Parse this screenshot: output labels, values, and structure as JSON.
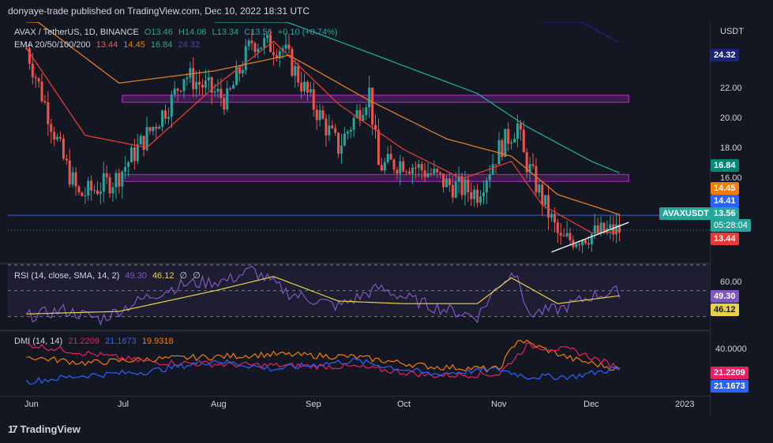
{
  "header": {
    "published": "donyaye-trade published on TradingView.com, Dec 10, 2022 18:31 UTC"
  },
  "footer": {
    "brand": "TradingView"
  },
  "legend_main": {
    "symbol": "AVAX / TetherUS, 1D, BINANCE",
    "o": "O13.46",
    "h": "H14.06",
    "l": "L13.34",
    "c": "C13.56",
    "chg": "+0.10 (+0.74%)"
  },
  "legend_ema": {
    "label": "EMA 20/50/100/200",
    "v20": "13.44",
    "v50": "14.45",
    "v100": "16.84",
    "v200": "24.32"
  },
  "legend_rsi": {
    "label": "RSI (14, close, SMA, 14, 2)",
    "rsi": "49.30",
    "sma": "46.12",
    "z1": "∅",
    "z2": "∅"
  },
  "legend_dmi": {
    "label": "DMI (14, 14)",
    "plus": "21.2209",
    "minus": "21.1673",
    "adx": "19.9318"
  },
  "axis_unit": "USDT",
  "price_ticks": [
    "22.00",
    "20.00",
    "18.00",
    "16.00"
  ],
  "price_tags": {
    "ema200": "24.32",
    "ema100": "16.84",
    "ema50": "14.45",
    "hline": "14.41",
    "symbol": "AVAXUSDT",
    "last": "13.56",
    "countdown": "05:28:04",
    "ema20": "13.44"
  },
  "rsi_ticks": {
    "t60": "60.00"
  },
  "rsi_tags": {
    "rsi": "49.30",
    "sma": "46.12"
  },
  "dmi_ticks": {
    "t40": "40.0000"
  },
  "dmi_tags": {
    "plus": "21.2209",
    "minus": "21.1673"
  },
  "time_axis": [
    "Jun",
    "Jul",
    "Aug",
    "Sep",
    "Oct",
    "Nov",
    "Dec",
    "2023"
  ],
  "colors": {
    "bg": "#131722",
    "up": "#26a69a",
    "down": "#ef5350",
    "ema20": "#e53935",
    "ema50": "#e07b24",
    "ema100": "#26a69a",
    "ema200": "#1a237e",
    "zone": "#9c27b0",
    "hline": "#2962ff",
    "rsi": "#7e57c2",
    "rsi_sma": "#e8d24a",
    "dmi_plus": "#e91e63",
    "dmi_minus": "#2962ff",
    "adx": "#f57c00"
  },
  "chart_data": [
    {
      "type": "candlestick",
      "title": "AVAX / TetherUS, 1D, BINANCE",
      "x_range": [
        "2022-05-26",
        "2023-01-08"
      ],
      "ylim": [
        11.7,
        25.5
      ],
      "y_unit": "USDT",
      "series": [
        {
          "name": "price_close",
          "x": [
            "2022-06-01",
            "2022-06-13",
            "2022-06-18",
            "2022-06-30",
            "2022-07-08",
            "2022-07-18",
            "2022-07-22",
            "2022-08-05",
            "2022-08-13",
            "2022-08-23",
            "2022-09-01",
            "2022-09-10",
            "2022-09-20",
            "2022-09-23",
            "2022-10-01",
            "2022-10-10",
            "2022-10-15",
            "2022-10-25",
            "2022-11-01",
            "2022-11-07",
            "2022-11-09",
            "2022-11-21",
            "2022-11-30",
            "2022-12-10"
          ],
          "values": [
            24.0,
            17.6,
            15.5,
            16.5,
            18.5,
            21.0,
            22.5,
            21.0,
            24.4,
            24.0,
            21.0,
            18.3,
            21.5,
            17.2,
            17.5,
            16.8,
            16.2,
            15.7,
            18.2,
            19.6,
            17.8,
            12.9,
            13.3,
            13.56
          ]
        },
        {
          "name": "EMA 20",
          "x": [
            "2022-06-01",
            "2022-06-20",
            "2022-07-10",
            "2022-08-01",
            "2022-08-20",
            "2022-09-10",
            "2022-10-01",
            "2022-10-20",
            "2022-11-05",
            "2022-11-15",
            "2022-12-01",
            "2022-12-10"
          ],
          "values": [
            24.0,
            19.0,
            18.3,
            21.8,
            24.4,
            20.8,
            18.2,
            16.5,
            17.5,
            15.0,
            13.4,
            13.44
          ]
        },
        {
          "name": "EMA 50",
          "x": [
            "2022-06-01",
            "2022-07-01",
            "2022-08-01",
            "2022-08-25",
            "2022-09-20",
            "2022-10-15",
            "2022-11-05",
            "2022-11-20",
            "2022-12-10"
          ],
          "values": [
            26.0,
            22.0,
            22.7,
            23.6,
            21.0,
            18.8,
            17.8,
            15.6,
            14.45
          ]
        },
        {
          "name": "EMA 100",
          "x": [
            "2022-08-01",
            "2022-09-01",
            "2022-10-01",
            "2022-10-25",
            "2022-11-10",
            "2022-12-01",
            "2022-12-10"
          ],
          "values": [
            27.0,
            25.0,
            23.0,
            21.4,
            19.5,
            17.5,
            16.84
          ]
        },
        {
          "name": "EMA 200",
          "x": [
            "2022-11-15",
            "2022-12-10"
          ],
          "values": [
            26.7,
            24.32
          ]
        }
      ],
      "zones": [
        {
          "from": 20.9,
          "to": 21.3
        },
        {
          "from": 16.35,
          "to": 16.75
        }
      ],
      "hline": 14.41,
      "trendline": {
        "x": [
          "2022-11-18",
          "2022-12-13"
        ],
        "y": [
          12.3,
          14.0
        ]
      },
      "ticks": [
        "22.00",
        "20.00",
        "18.00",
        "16.00"
      ]
    },
    {
      "type": "line",
      "title": "RSI (14, close, SMA, 14, 2)",
      "ylim": [
        20,
        70
      ],
      "bands": [
        30,
        50,
        70
      ],
      "series": [
        {
          "name": "RSI",
          "x": [
            "2022-06-01",
            "2022-06-13",
            "2022-06-25",
            "2022-07-10",
            "2022-07-22",
            "2022-08-05",
            "2022-08-13",
            "2022-08-25",
            "2022-09-10",
            "2022-09-23",
            "2022-10-10",
            "2022-10-25",
            "2022-11-01",
            "2022-11-07",
            "2022-11-10",
            "2022-11-21",
            "2022-12-01",
            "2022-12-10"
          ],
          "values": [
            30,
            35,
            28,
            45,
            55,
            58,
            66,
            48,
            38,
            52,
            38,
            30,
            55,
            66,
            32,
            36,
            46,
            49.3
          ]
        },
        {
          "name": "SMA",
          "x": [
            "2022-06-01",
            "2022-07-01",
            "2022-08-01",
            "2022-08-20",
            "2022-09-10",
            "2022-10-01",
            "2022-10-25",
            "2022-11-05",
            "2022-11-20",
            "2022-12-10"
          ],
          "values": [
            32,
            34,
            50,
            61,
            42,
            40,
            40,
            60,
            40,
            46.12
          ]
        }
      ],
      "ticks": [
        "60.00"
      ]
    },
    {
      "type": "line",
      "title": "DMI (14, 14)",
      "ylim": [
        0,
        50
      ],
      "series": [
        {
          "name": "+DI",
          "x": [
            "2022-06-01",
            "2022-06-20",
            "2022-07-10",
            "2022-08-01",
            "2022-08-20",
            "2022-09-15",
            "2022-10-10",
            "2022-11-01",
            "2022-11-10",
            "2022-11-25",
            "2022-12-10"
          ],
          "values": [
            40,
            33,
            26,
            24,
            23,
            22,
            15,
            16,
            39,
            35,
            21.2209
          ]
        },
        {
          "name": "-DI",
          "x": [
            "2022-06-01",
            "2022-06-20",
            "2022-07-10",
            "2022-08-01",
            "2022-08-20",
            "2022-09-15",
            "2022-10-10",
            "2022-11-01",
            "2022-11-10",
            "2022-11-25",
            "2022-12-10"
          ],
          "values": [
            10,
            15,
            18,
            27,
            20,
            27,
            16,
            20,
            14,
            14,
            21.1673
          ]
        },
        {
          "name": "ADX",
          "x": [
            "2022-06-01",
            "2022-06-20",
            "2022-07-10",
            "2022-08-01",
            "2022-08-20",
            "2022-09-15",
            "2022-10-10",
            "2022-11-01",
            "2022-11-07",
            "2022-11-25",
            "2022-12-10"
          ],
          "values": [
            30,
            25,
            28,
            30,
            32,
            30,
            22,
            20,
            44,
            28,
            19.9318
          ]
        }
      ],
      "ticks": [
        "40.0000"
      ]
    }
  ]
}
